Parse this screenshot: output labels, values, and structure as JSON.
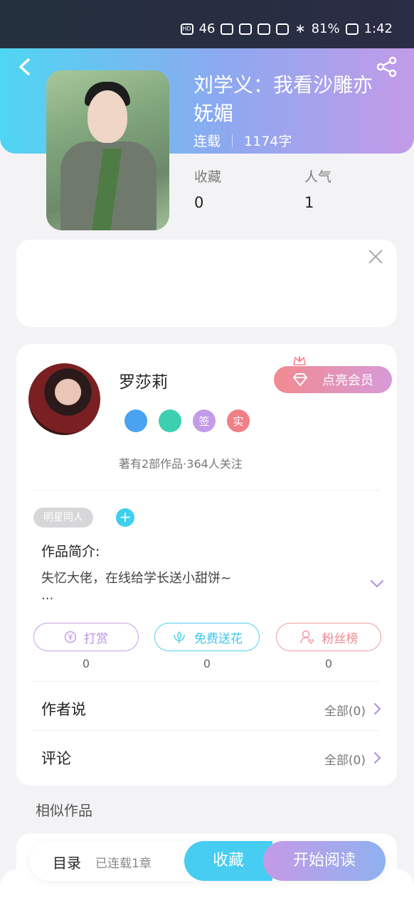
{
  "status_bar": {
    "signal": "46",
    "battery": "81%",
    "time": "1:42"
  },
  "book": {
    "title": "刘学义：我看沙雕亦妩媚",
    "status": "连载",
    "word_count": "1174字"
  },
  "stats": [
    {
      "label": "收藏",
      "value": "0"
    },
    {
      "label": "人气",
      "value": "1"
    }
  ],
  "author": {
    "name": "罗莎莉",
    "vip_label": "点亮会员",
    "badges": [
      {
        "text": "",
        "color": "#4aa3f0"
      },
      {
        "text": "",
        "color": "#3dd0b0"
      },
      {
        "text": "签",
        "color": "#c49be9"
      },
      {
        "text": "实",
        "color": "#f07f86"
      }
    ],
    "summary": "著有2部作品·364人关注"
  },
  "tag": {
    "label": "明星同人",
    "add": "+"
  },
  "intro": {
    "title": "作品简介:",
    "text": "失忆大佬，在线给学长送小甜饼~",
    "ellipsis": "..."
  },
  "actions": [
    {
      "label": "打赏",
      "count": "0",
      "color": "#c89ee6"
    },
    {
      "label": "免费送花",
      "count": "0",
      "color": "#4fd0ef"
    },
    {
      "label": "粉丝榜",
      "count": "0",
      "color": "#f19aa0"
    }
  ],
  "rows": [
    {
      "title": "作者说",
      "all": "全部(0)"
    },
    {
      "title": "评论",
      "all": "全部(0)"
    }
  ],
  "similar": {
    "title": "相似作品"
  },
  "bottom_bar": {
    "toc": "目录",
    "toc_sub": "已连载1章",
    "favorite": "收藏",
    "read": "开始阅读"
  },
  "colors": {
    "accent_cyan": "#46cdf1",
    "accent_purple": "#c59ae6"
  }
}
